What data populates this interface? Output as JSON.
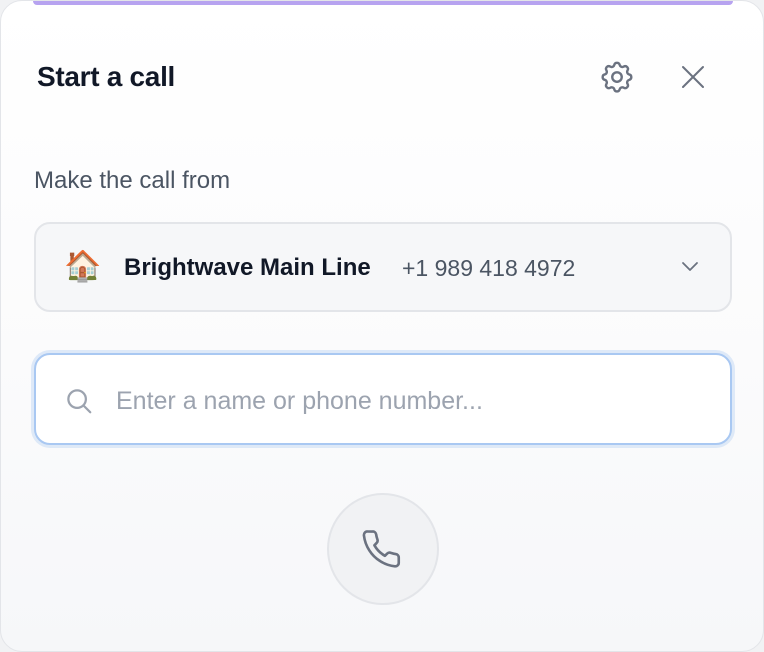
{
  "dialog": {
    "title": "Start a call",
    "accent_color": "#b7a3f0",
    "settings_icon": "gear-icon",
    "close_icon": "close-icon"
  },
  "from": {
    "label": "Make the call from",
    "selected_line": {
      "emoji": "🏠",
      "name": "Brightwave Main Line",
      "number": "+1 989 418 4972"
    },
    "dropdown_icon": "chevron-down-icon"
  },
  "search": {
    "placeholder": "Enter a name or phone number...",
    "value": "",
    "icon": "search-icon"
  },
  "call_button": {
    "icon": "phone-icon"
  }
}
